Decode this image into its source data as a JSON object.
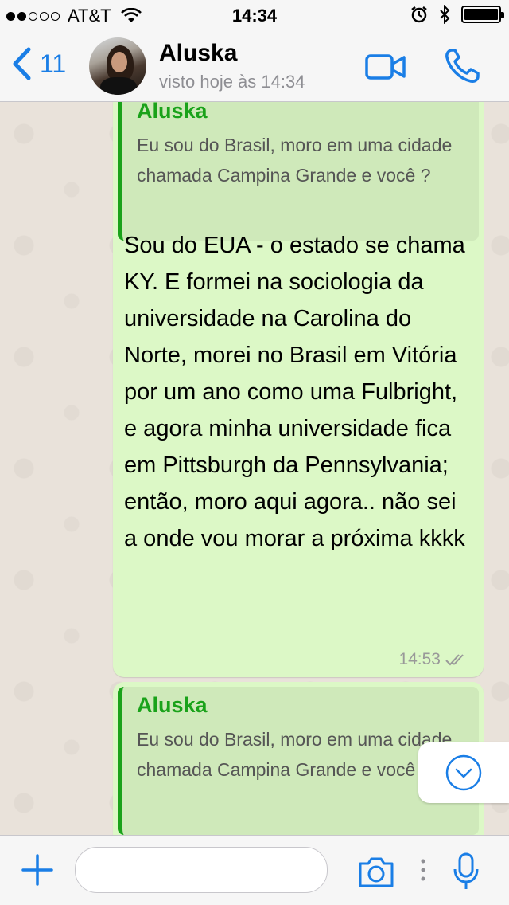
{
  "status_bar": {
    "carrier": "AT&T",
    "time": "14:34"
  },
  "header": {
    "back_count": "11",
    "contact_name": "Aluska",
    "contact_status": "visto hoje às 14:34"
  },
  "messages": [
    {
      "quote_author": "Aluska",
      "quote_text": "Eu sou do Brasil, moro em uma cidade chamada Campina Grande e você ?",
      "text": "Sou do EUA - o estado se chama KY. E formei na sociologia da universidade na Carolina do Norte, morei no Brasil em Vitória por um ano como uma Fulbright, e agora minha universidade fica em Pittsburgh da Pennsylvania; então, moro aqui agora.. não sei a onde vou morar a próxima kkkk",
      "time": "14:53"
    },
    {
      "quote_author": "Aluska",
      "quote_text": "Eu sou do Brasil, moro em uma cidade chamada Campina Grande e você ?"
    }
  ],
  "input": {
    "placeholder": ""
  },
  "colors": {
    "accent": "#1a7ee6",
    "bubble_out": "#dcf8c6",
    "quote_author": "#1aa21a",
    "chat_bg": "#e9e2da"
  },
  "icons": [
    "back-chevron-icon",
    "video-call-icon",
    "phone-icon",
    "double-check-icon",
    "scroll-down-icon",
    "plus-icon",
    "camera-icon",
    "more-dots-icon",
    "microphone-icon",
    "wifi-icon",
    "alarm-icon",
    "bluetooth-icon",
    "battery-icon"
  ]
}
